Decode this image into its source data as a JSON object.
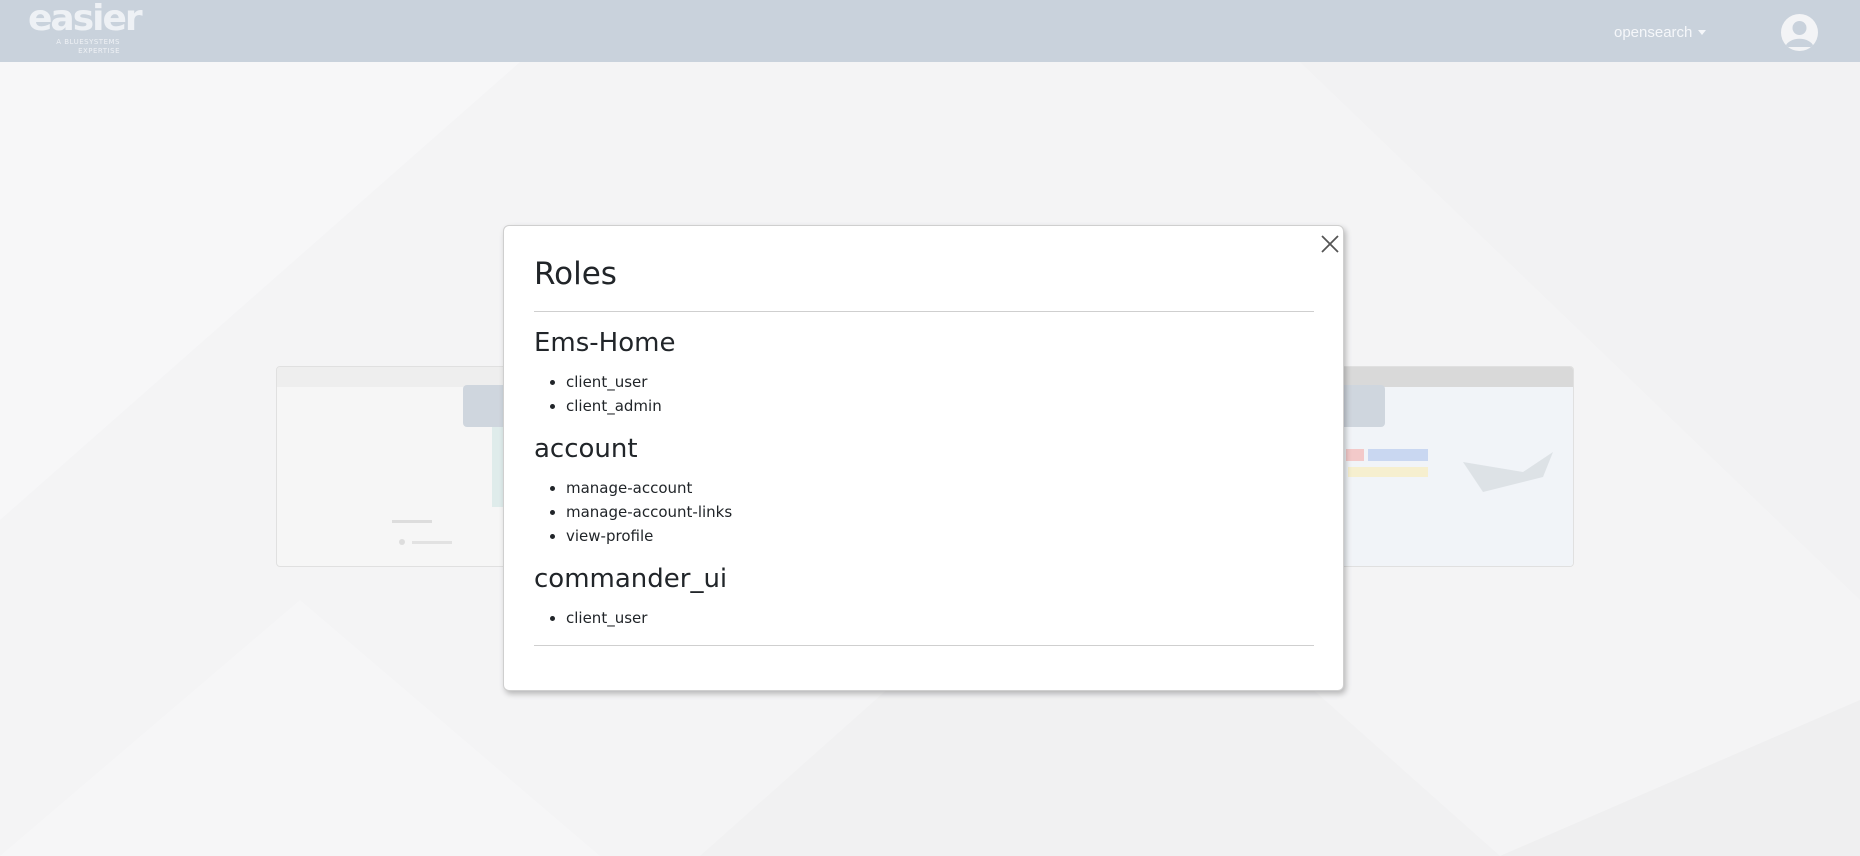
{
  "navbar": {
    "logo": {
      "word": "easier",
      "tagline_1": "A BLUESYSTEMS",
      "tagline_2": "EXPERTISE"
    },
    "dropdown_label": "opensearch",
    "avatar_icon": "user-avatar-icon"
  },
  "modal": {
    "title": "Roles",
    "close_icon": "close-icon",
    "groups": [
      {
        "name": "Ems-Home",
        "roles": [
          "client_user",
          "client_admin"
        ]
      },
      {
        "name": "account",
        "roles": [
          "manage-account",
          "manage-account-links",
          "view-profile"
        ]
      },
      {
        "name": "commander_ui",
        "roles": [
          "client_user"
        ]
      }
    ]
  },
  "colors": {
    "navbar_bg": "#c9d2dc",
    "page_bg": "#f4f4f5",
    "modal_bg": "#ffffff",
    "text": "#212529"
  }
}
